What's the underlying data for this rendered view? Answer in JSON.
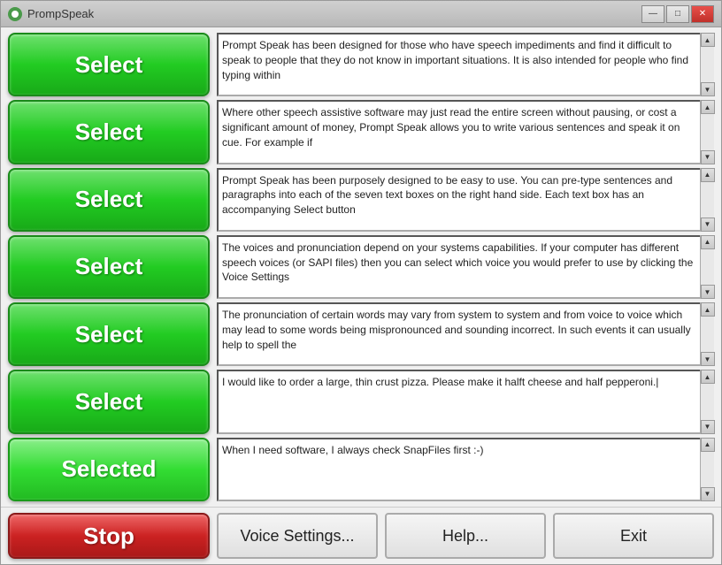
{
  "window": {
    "title": "PrompSpeak",
    "icon": "speech-icon"
  },
  "titlebar": {
    "minimize_label": "—",
    "restore_label": "□",
    "close_label": "✕"
  },
  "rows": [
    {
      "button_label": "Select",
      "text": "Prompt Speak has been designed for those who have speech impediments and find it difficult to speak to people that they do not know in important situations. It is also intended for people who find typing within"
    },
    {
      "button_label": "Select",
      "text": "Where other speech assistive software may just read the entire screen without pausing, or cost a significant amount of money, Prompt Speak allows you to write various sentences and speak it on cue. For example if"
    },
    {
      "button_label": "Select",
      "text": "Prompt Speak has been purposely designed to be easy to use. You can pre-type sentences and paragraphs into each of the seven text boxes on the right hand side. Each text box has an accompanying Select button"
    },
    {
      "button_label": "Select",
      "text": "The voices and pronunciation depend on your systems capabilities. If your computer has different speech voices (or SAPI files) then you can select which voice you would prefer to use by clicking the Voice Settings"
    },
    {
      "button_label": "Select",
      "text": "The pronunciation of certain words may vary from system to system and from voice to voice which may lead to some words being mispronounced and sounding incorrect. In such events it can usually help to spell the"
    },
    {
      "button_label": "Select",
      "text": "I would like to order a large, thin crust pizza. Please make it halft cheese and half pepperoni.|"
    },
    {
      "button_label": "Selected",
      "text": "When I need software, I always check SnapFiles first :-)"
    }
  ],
  "footer": {
    "stop_label": "Stop",
    "voice_settings_label": "Voice Settings...",
    "help_label": "Help...",
    "exit_label": "Exit"
  }
}
